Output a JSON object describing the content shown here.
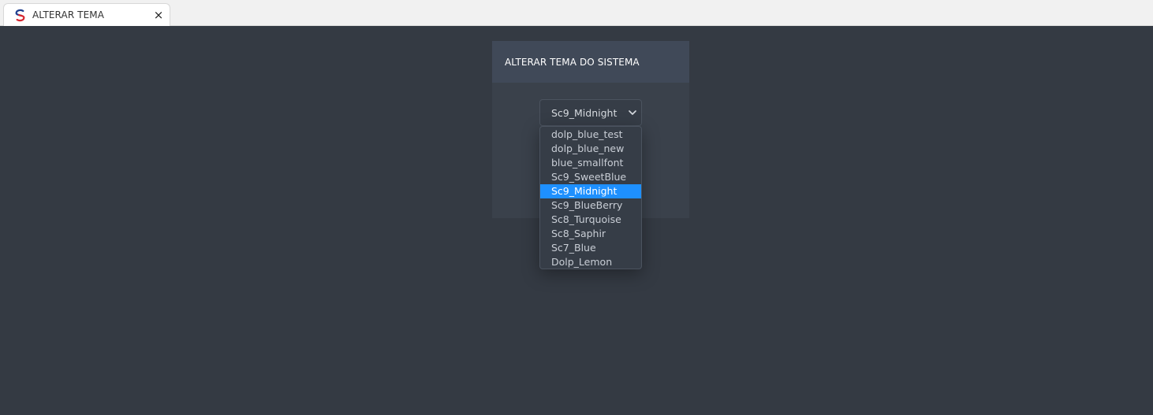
{
  "browser": {
    "tab_title": "ALTERAR TEMA",
    "tab_logo": "app-logo-icon",
    "tab_close_icon": "close-icon",
    "tab_close_label": "×"
  },
  "panel": {
    "title": "ALTERAR TEMA DO SISTEMA"
  },
  "theme_select": {
    "value": "Sc9_Midnight",
    "chevron_icon": "chevron-down-icon",
    "options": [
      "dolp_blue_test",
      "dolp_blue_new",
      "blue_smallfont",
      "Sc9_SweetBlue",
      "Sc9_Midnight",
      "Sc9_BlueBerry",
      "Sc8_Turquoise",
      "Sc8_Saphir",
      "Sc7_Blue",
      "Dolp_Lemon"
    ],
    "selected_index": 4
  },
  "colors": {
    "page_background": "#343a43",
    "panel_header": "#404958",
    "panel_body": "#3a414b",
    "highlight": "#1e90ff"
  }
}
